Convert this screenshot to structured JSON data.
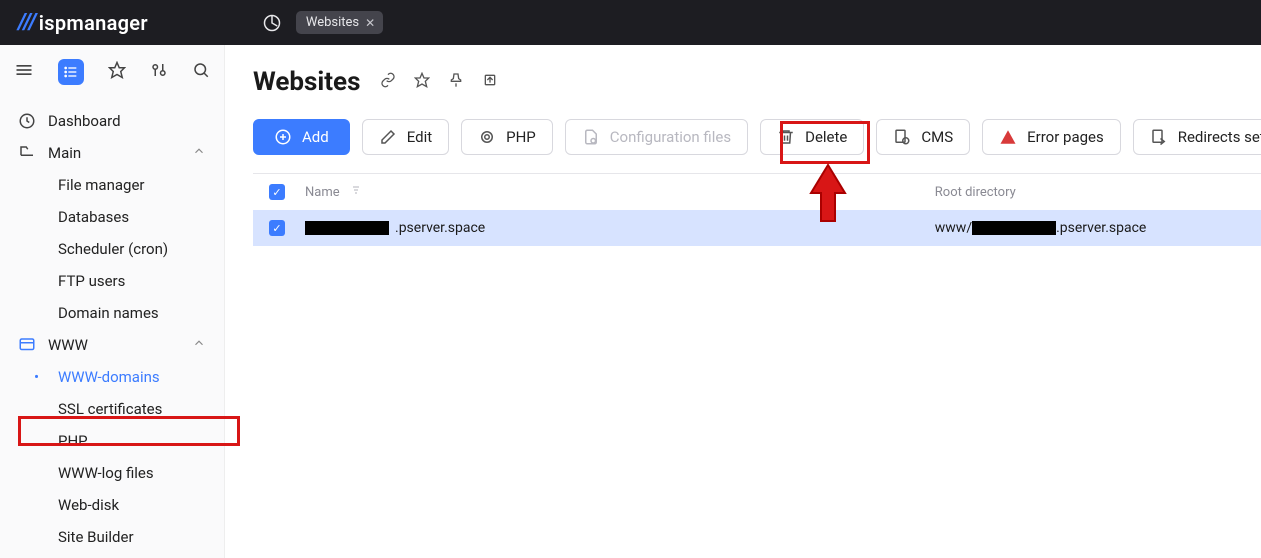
{
  "app_name": "ispmanager",
  "tab": {
    "label": "Websites"
  },
  "sidebar_icons": {
    "active": "list"
  },
  "nav": {
    "dashboard": "Dashboard",
    "main": {
      "label": "Main",
      "items": {
        "file_manager": "File manager",
        "databases": "Databases",
        "scheduler": "Scheduler (cron)",
        "ftp_users": "FTP users",
        "domain_names": "Domain names"
      }
    },
    "www": {
      "label": "WWW",
      "items": {
        "www_domains": "WWW-domains",
        "ssl_certs": "SSL certificates",
        "php": "PHP",
        "www_log": "WWW-log files",
        "web_disk": "Web-disk",
        "site_builder": "Site Builder"
      }
    }
  },
  "page": {
    "title": "Websites"
  },
  "toolbar": {
    "add": "Add",
    "edit": "Edit",
    "php": "PHP",
    "config_files": "Configuration files",
    "delete": "Delete",
    "cms": "CMS",
    "error_pages": "Error pages",
    "redirects": "Redirects settings"
  },
  "table": {
    "columns": {
      "name": "Name",
      "root": "Root directory"
    },
    "rows": [
      {
        "name_suffix": ".pserver.space",
        "root_prefix": "www/",
        "root_suffix": ".pserver.space"
      }
    ]
  }
}
